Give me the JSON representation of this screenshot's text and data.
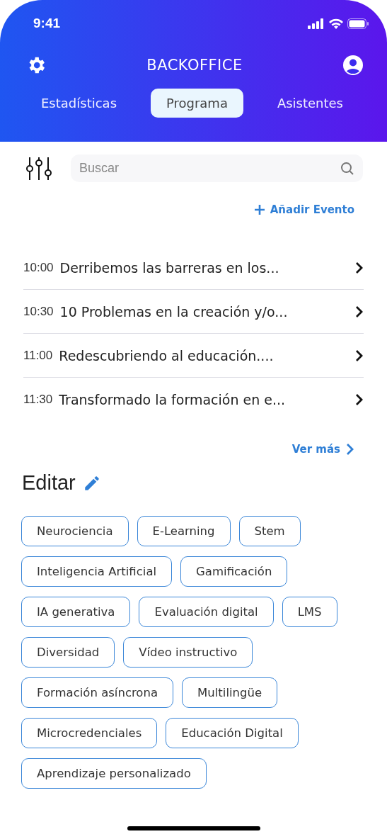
{
  "status_bar": {
    "time": "9:41"
  },
  "header": {
    "title": "BACKOFFICE"
  },
  "tabs": [
    {
      "label": "Estadísticas",
      "selected": false
    },
    {
      "label": "Programa",
      "selected": true
    },
    {
      "label": "Asistentes",
      "selected": false
    }
  ],
  "search": {
    "placeholder": "Buscar"
  },
  "add_event": {
    "label": "Añadir Evento"
  },
  "events": [
    {
      "time": "10:00",
      "title": "Derribemos las barreras en los..."
    },
    {
      "time": "10:30",
      "title": "10 Problemas en la creación y/o..."
    },
    {
      "time": "11:00",
      "title": "Redescubriendo al educación...."
    },
    {
      "time": "11:30",
      "title": "Transformado la formación en e..."
    }
  ],
  "see_more": {
    "label": "Ver más"
  },
  "edit_section": {
    "title": "Editar"
  },
  "tags": [
    "Neurociencia",
    "E-Learning",
    "Stem",
    "Inteligencia Artificial",
    "Gamificación",
    "IA generativa",
    "Evaluación digital",
    "LMS",
    "Diversidad",
    "Vídeo instructivo",
    "Formación asíncrona",
    "Multilingüe",
    "Microcredenciales",
    "Educación Digital",
    "Aprendizaje personalizado"
  ]
}
